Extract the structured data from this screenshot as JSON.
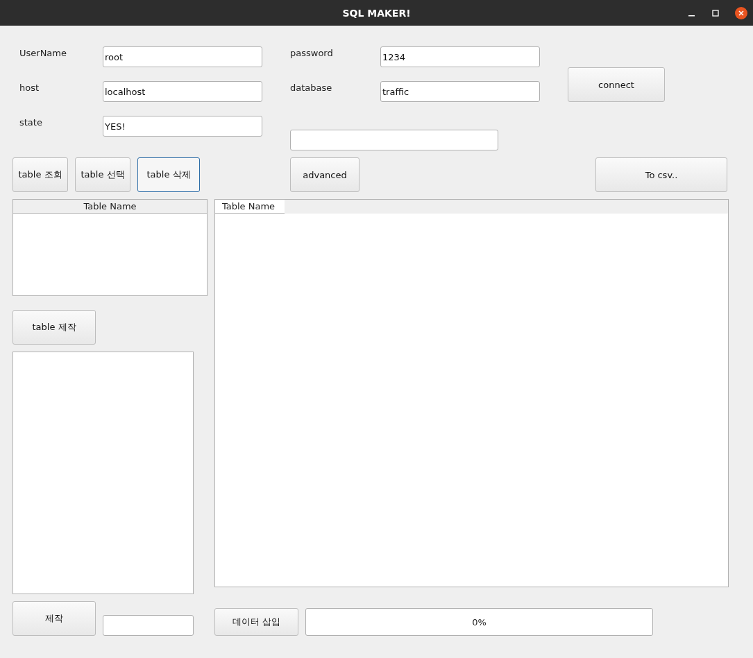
{
  "window": {
    "title": "SQL MAKER!"
  },
  "connection_fields": [
    {
      "label": "UserName",
      "value": "root"
    },
    {
      "label": "host",
      "value": "localhost"
    },
    {
      "label": "state",
      "value": "YES!"
    },
    {
      "label": "password",
      "value": "1234"
    },
    {
      "label": "database",
      "value": "traffic"
    }
  ],
  "connect_button": "connect",
  "table_buttons": [
    {
      "label": "table 조회",
      "focused": false
    },
    {
      "label": "table 선택",
      "focused": false
    },
    {
      "label": "table 삭제",
      "focused": true
    }
  ],
  "advanced_button": "advanced",
  "csv_button": "To csv..",
  "table_list": {
    "columns": [
      "Table Name"
    ]
  },
  "create_table_button": "table 제작",
  "data_table": {
    "columns": [
      "Table Name"
    ]
  },
  "make_button": "제작",
  "insert_button": "데이터 삽입",
  "progress": {
    "level": 0,
    "reading": "0%"
  }
}
